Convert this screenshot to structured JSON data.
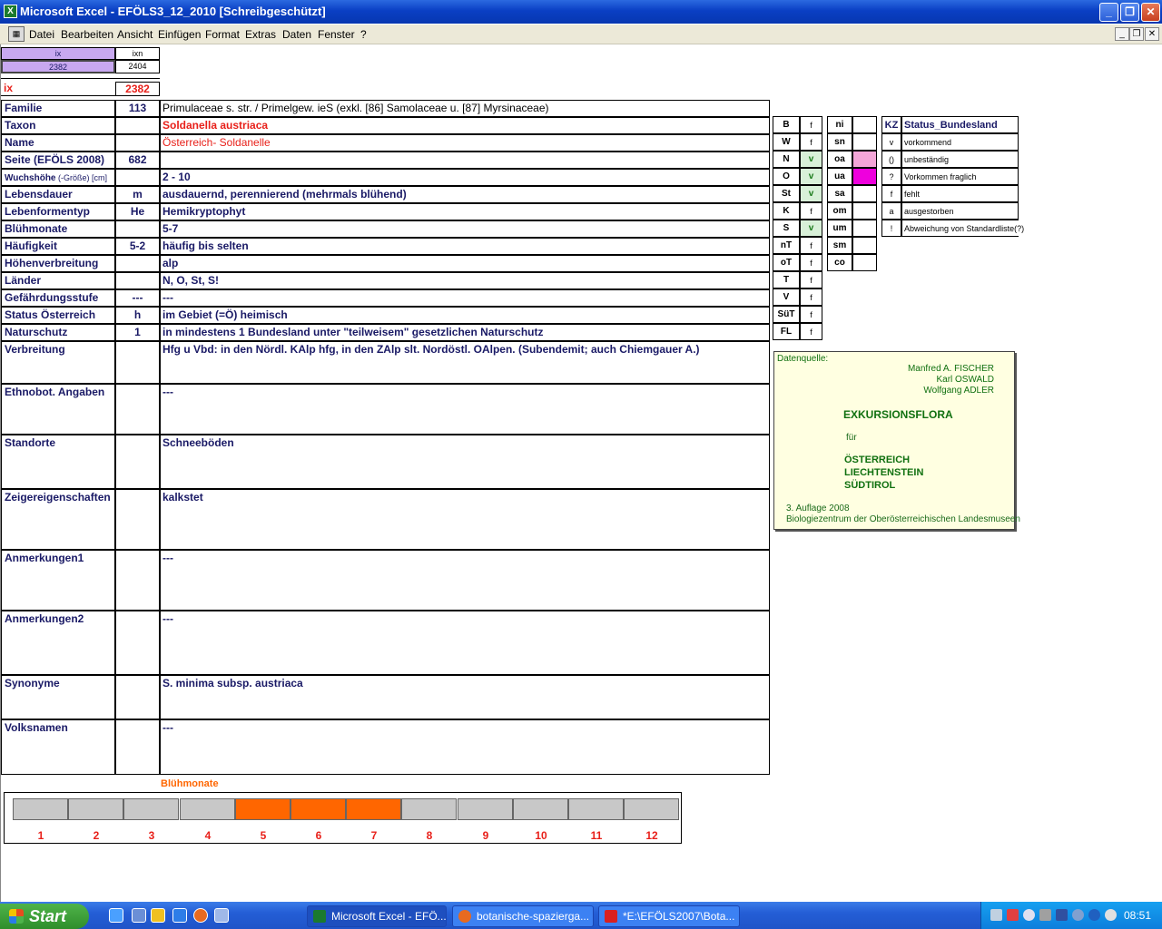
{
  "window": {
    "title": "Microsoft Excel - EFÖLS3_12_2010  [Schreibgeschützt]",
    "app_icon": "excel-icon"
  },
  "menu": {
    "items": [
      "Datei",
      "Bearbeiten",
      "Ansicht",
      "Einfügen",
      "Format",
      "Extras",
      "Daten",
      "Fenster",
      "?"
    ]
  },
  "top": {
    "ix_header": "ix",
    "ixn_header": "ixn",
    "ix_value": "2382",
    "ixn_value": "2404",
    "ix_label": "ix",
    "ix_red_value": "2382"
  },
  "rows": [
    {
      "label": "Familie",
      "code": "113",
      "value": "Primulaceae s. str.  /  Primelgew. ieS (exkl. [86] Samolaceae u. [87] Myrsinaceae)"
    },
    {
      "label": "Taxon",
      "code": "",
      "value": "Soldanella austriaca"
    },
    {
      "label": "Name",
      "code": "",
      "value": "Österreich- Soldanelle"
    },
    {
      "label": "Seite (EFÖLS 2008)",
      "code": "682",
      "value": ""
    },
    {
      "label": "Wuchshöhe",
      "label_suffix": "(-Größe) [cm]",
      "code": "",
      "value": " 2 - 10"
    },
    {
      "label": "Lebensdauer",
      "code": "m",
      "value": "ausdauernd, perennierend (mehrmals blühend)"
    },
    {
      "label": "Lebenformentyp",
      "code": "He",
      "value": "Hemikryptophyt"
    },
    {
      "label": "Blühmonate",
      "code": "",
      "value": " 5-7"
    },
    {
      "label": "Häufigkeit",
      "code": "5-2",
      "value": "häufig bis selten"
    },
    {
      "label": "Höhenverbreitung",
      "code": "",
      "value": "alp"
    },
    {
      "label": "Länder",
      "code": "",
      "value": " N, O, St, S!"
    },
    {
      "label": "Gefährdungsstufe",
      "code": "---",
      "value": " ---"
    },
    {
      "label": "Status Österreich",
      "code": "h",
      "value": "im Gebiet (=Ö) heimisch"
    },
    {
      "label": "Naturschutz",
      "code": "1",
      "value": "in mindestens 1 Bundesland unter \"teilweisem\" gesetzlichen Naturschutz"
    },
    {
      "label": "Verbreitung",
      "code": "",
      "value": "Hfg u Vbd: in den Nördl. KAlp hfg, in den ZAlp slt. Nordöstl. OAlpen. (Subendemit; auch Chiemgauer A.)"
    },
    {
      "label": "Ethnobot. Angaben",
      "code": "",
      "value": "---"
    },
    {
      "label": "Standorte",
      "code": "",
      "value": "Schneeböden"
    },
    {
      "label": "Zeigereigenschaften",
      "code": "",
      "value": "kalkstet"
    },
    {
      "label": "Anmerkungen1",
      "code": "",
      "value": "---"
    },
    {
      "label": "Anmerkungen2",
      "code": "",
      "value": "---"
    },
    {
      "label": "Synonyme",
      "code": "",
      "value": "S. minima subsp. austriaca"
    },
    {
      "label": "Volksnamen",
      "code": "",
      "value": "---"
    }
  ],
  "states": [
    {
      "code": "B",
      "val": "f"
    },
    {
      "code": "W",
      "val": "f"
    },
    {
      "code": "N",
      "val": "v"
    },
    {
      "code": "O",
      "val": "v"
    },
    {
      "code": "St",
      "val": "v"
    },
    {
      "code": "K",
      "val": "f"
    },
    {
      "code": "S",
      "val": "v"
    },
    {
      "code": "nT",
      "val": "f"
    },
    {
      "code": "oT",
      "val": "f"
    },
    {
      "code": "T",
      "val": "f"
    },
    {
      "code": "V",
      "val": "f"
    },
    {
      "code": "SüT",
      "val": "f"
    },
    {
      "code": "FL",
      "val": "f"
    }
  ],
  "regions": [
    "ni",
    "sn",
    "oa",
    "ua",
    "sa",
    "om",
    "um",
    "sm",
    "co"
  ],
  "region_colors": {
    "oa": "#f4a6d8",
    "ua": "#ee00dd"
  },
  "legend": {
    "header_code": "KZ",
    "header_label": "Status_Bundesland",
    "items": [
      {
        "code": "v",
        "label": "vorkommend"
      },
      {
        "code": "()",
        "label": "unbeständig"
      },
      {
        "code": "?",
        "label": "Vorkommen fraglich"
      },
      {
        "code": "f",
        "label": "fehlt"
      },
      {
        "code": "a",
        "label": "ausgestorben"
      },
      {
        "code": "!",
        "label": "Abweichung von Standardliste(?)"
      }
    ]
  },
  "datasource": {
    "label": "Datenquelle:",
    "authors": [
      "Manfred A. FISCHER",
      "Karl OSWALD",
      "Wolfgang ADLER"
    ],
    "title": "EXKURSIONSFLORA",
    "for": "für",
    "countries": [
      "ÖSTERREICH",
      "LIECHTENSTEIN",
      "SÜDTIROL"
    ],
    "edition": "3. Auflage 2008",
    "publisher": "Biologiezentrum der Oberösterreichischen Landesmuseen"
  },
  "bloom": {
    "title": "Blühmonate",
    "months": [
      "1",
      "2",
      "3",
      "4",
      "5",
      "6",
      "7",
      "8",
      "9",
      "10",
      "11",
      "12"
    ],
    "active": [
      5,
      6,
      7
    ],
    "active_color": "#ff6600",
    "inactive_color": "#c8c8c8"
  },
  "taskbar": {
    "start": "Start",
    "tasks": [
      "Microsoft Excel - EFÖ...",
      "botanische-spazierga...",
      "*E:\\EFÖLS2007\\Bota..."
    ],
    "clock": "08:51"
  }
}
